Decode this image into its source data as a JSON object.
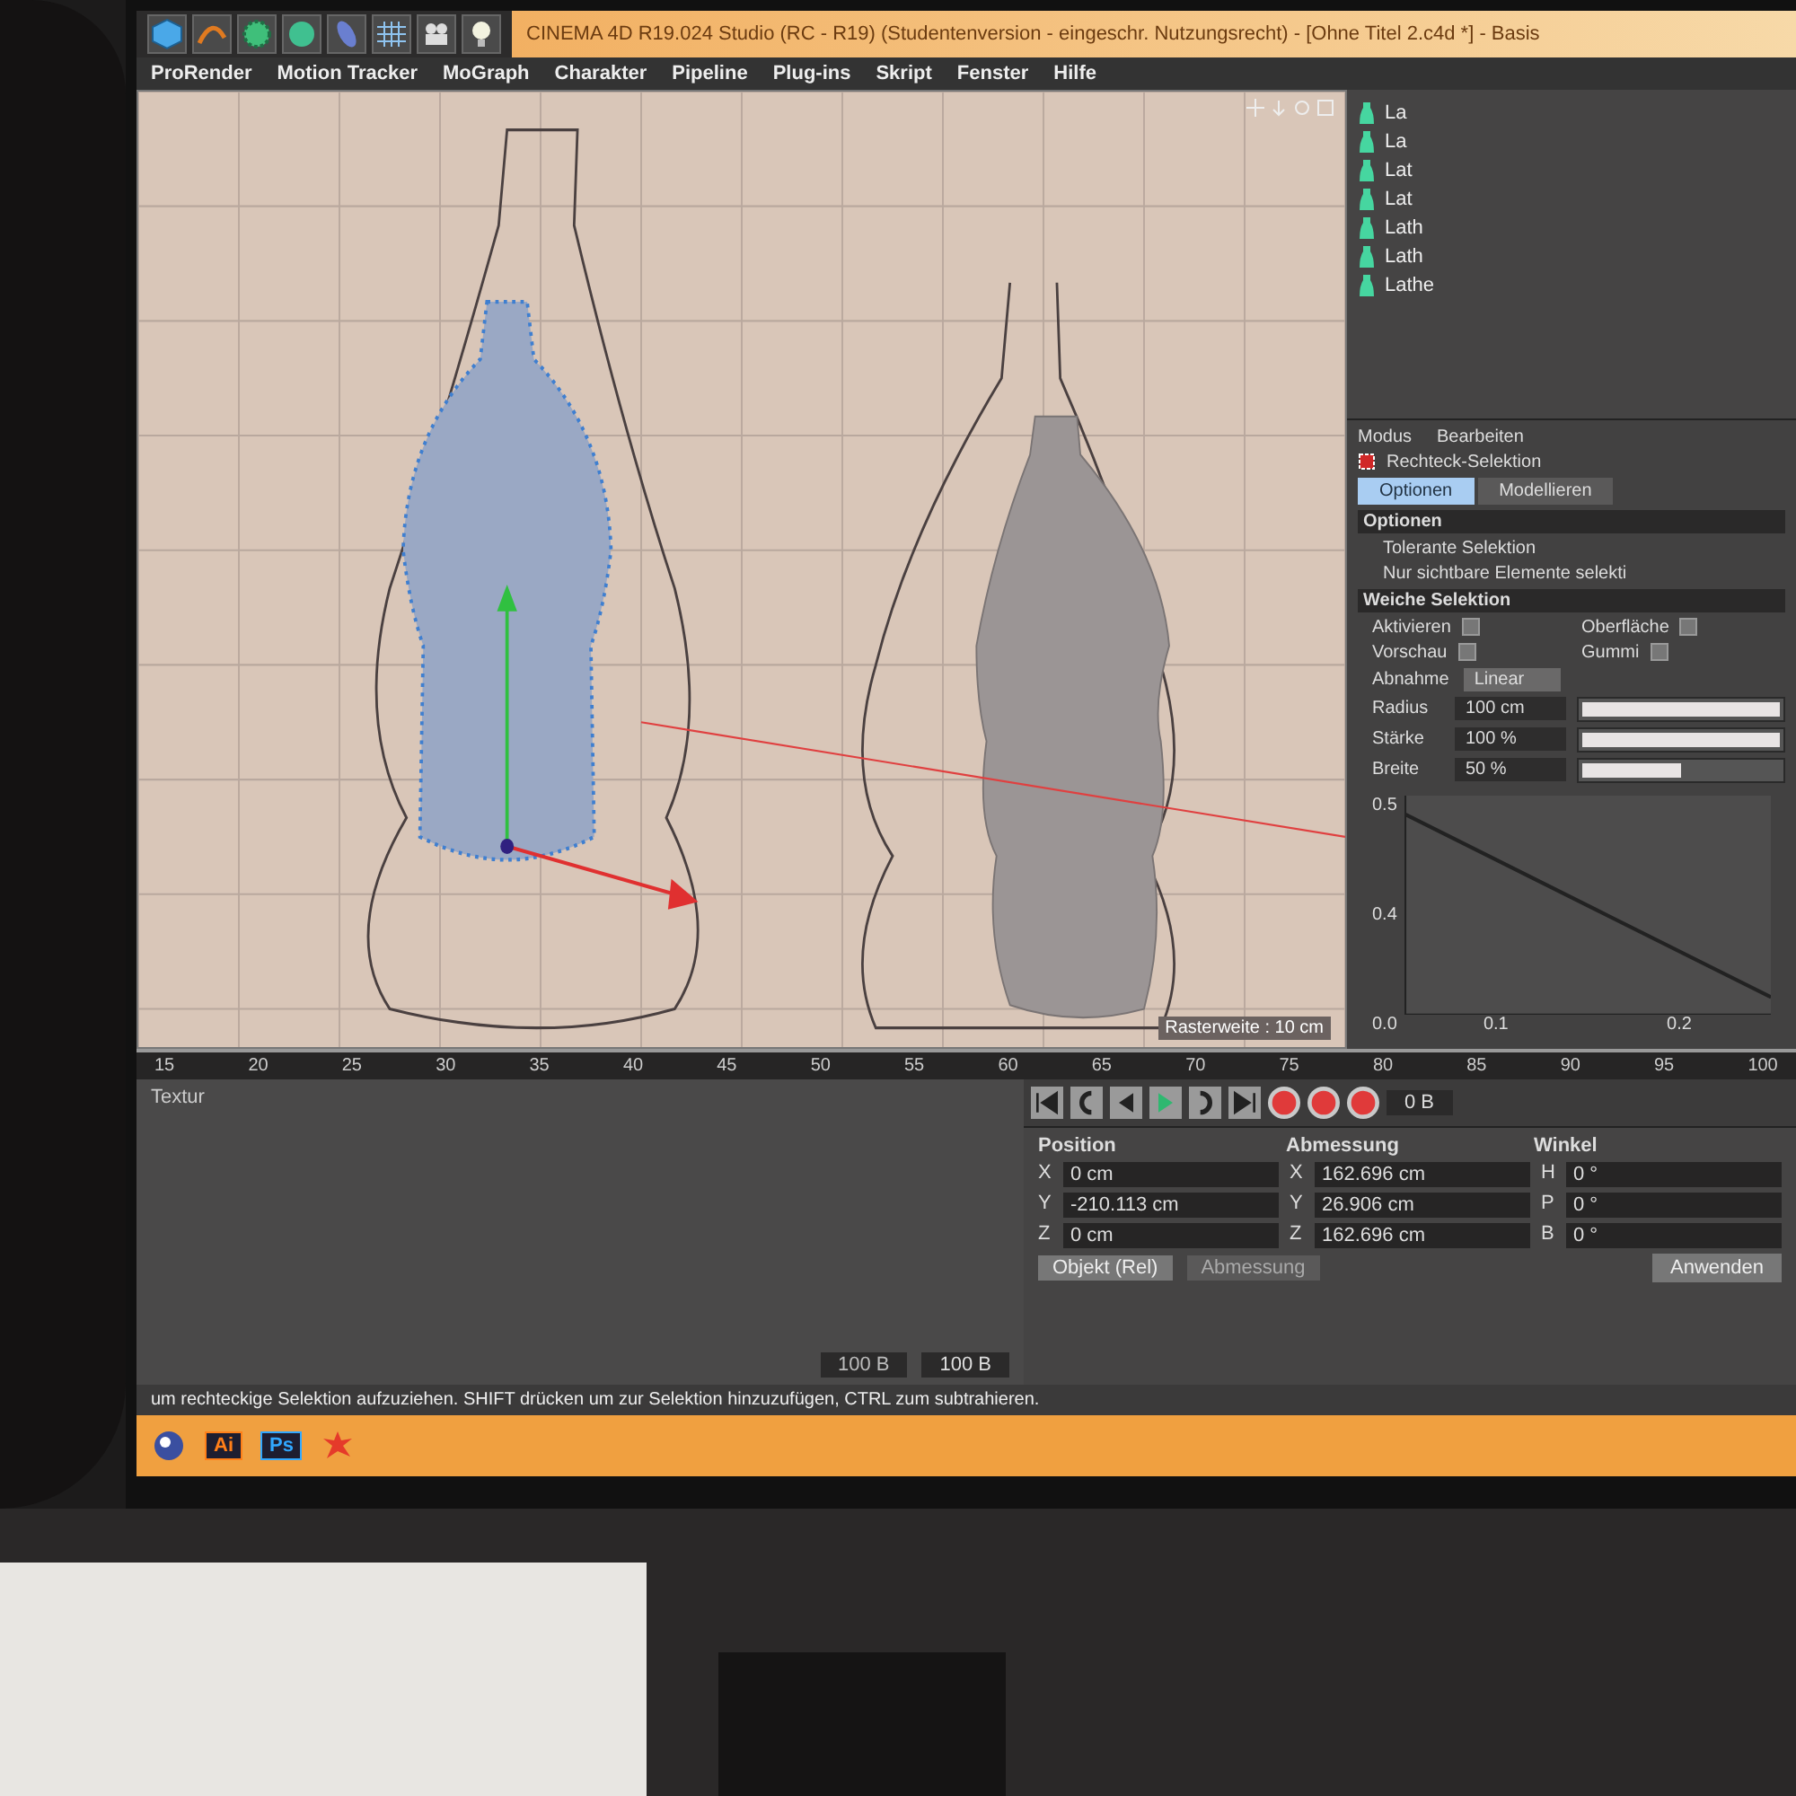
{
  "title_bar": {
    "title": "CINEMA 4D R19.024 Studio (RC - R19) (Studentenversion - eingeschr. Nutzungsrecht) - [Ohne Titel 2.c4d *] - Basis"
  },
  "menubar": {
    "items": [
      "ProRender",
      "Motion Tracker",
      "MoGraph",
      "Charakter",
      "Pipeline",
      "Plug-ins",
      "Skript",
      "Fenster",
      "Hilfe"
    ]
  },
  "object_manager": {
    "items": [
      {
        "name": "La"
      },
      {
        "name": "La"
      },
      {
        "name": "Lat"
      },
      {
        "name": "Lat"
      },
      {
        "name": "Lath"
      },
      {
        "name": "Lath"
      },
      {
        "name": "Lathe"
      }
    ]
  },
  "viewport": {
    "grid_size": "Rasterweite : 10 cm"
  },
  "timeline": {
    "ticks": [
      "15",
      "20",
      "25",
      "30",
      "35",
      "40",
      "45",
      "50",
      "55",
      "60",
      "65",
      "70",
      "75",
      "80",
      "85",
      "90",
      "95",
      "100"
    ],
    "track_label": "Textur",
    "end_frame": "100 B",
    "slider_value": "100 B",
    "current_frame": "0 B"
  },
  "coordinates": {
    "headers": [
      "Position",
      "Abmessung",
      "Winkel"
    ],
    "rows": [
      {
        "axes": [
          "X",
          "X",
          "H"
        ],
        "values": [
          "0 cm",
          "162.696 cm",
          "0 °"
        ]
      },
      {
        "axes": [
          "Y",
          "Y",
          "P"
        ],
        "values": [
          "-210.113 cm",
          "26.906 cm",
          "0 °"
        ]
      },
      {
        "axes": [
          "Z",
          "Z",
          "B"
        ],
        "values": [
          "0 cm",
          "162.696 cm",
          "0 °"
        ]
      }
    ],
    "mode": "Objekt (Rel)",
    "size_mode": "Abmessung",
    "apply": "Anwenden"
  },
  "attributes": {
    "menu": [
      "Modus",
      "Bearbeiten"
    ],
    "tool": "Rechteck-Selektion",
    "tabs": [
      {
        "label": "Optionen",
        "selected": true
      },
      {
        "label": "Modellieren",
        "selected": false
      }
    ],
    "section_options": "Optionen",
    "options": [
      "Tolerante Selektion",
      "Nur sichtbare Elemente selekti"
    ],
    "section_soft": "Weiche Selektion",
    "checks": [
      {
        "label": "Aktivieren",
        "checked": false
      },
      {
        "label": "Oberfläche",
        "checked": false
      },
      {
        "label": "Vorschau",
        "checked": false
      },
      {
        "label": "Gummi",
        "checked": false
      }
    ],
    "falloff": {
      "label": "Abnahme",
      "value": "Linear"
    },
    "sliders": [
      {
        "label": "Radius",
        "value": "100 cm",
        "level": 1
      },
      {
        "label": "Stärke",
        "value": "100 %",
        "level": 1
      },
      {
        "label": "Breite",
        "value": "50 %",
        "level": 0.5
      }
    ],
    "graph_yticks": [
      "0.5",
      "0.4",
      "0.0"
    ],
    "graph_xticks": [
      "0.1",
      "0.2"
    ]
  },
  "status_bar": {
    "text": "um rechteckige Selektion aufzuziehen. SHIFT drücken um zur Selektion hinzuzufügen, CTRL zum subtrahieren."
  },
  "taskbar": {
    "apps": [
      {
        "kind": "cinema"
      },
      {
        "kind": "ai",
        "label": "Ai"
      },
      {
        "kind": "ps",
        "label": "Ps"
      },
      {
        "kind": "splat"
      }
    ]
  }
}
